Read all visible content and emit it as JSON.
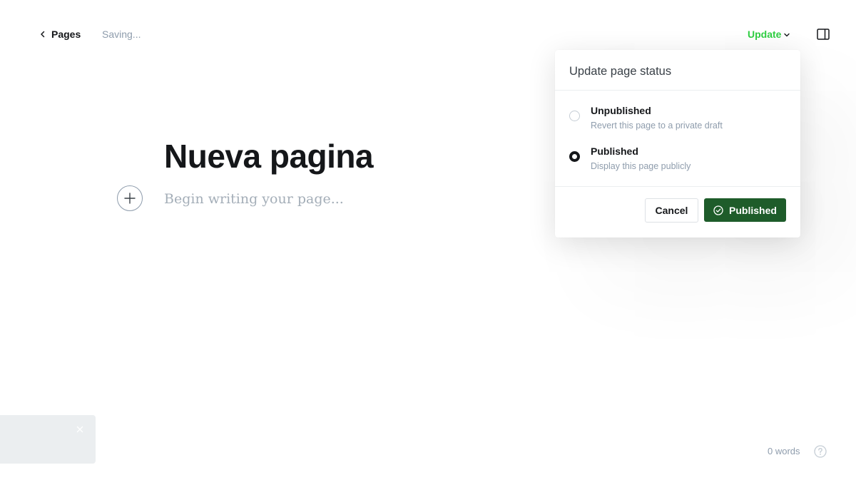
{
  "topbar": {
    "back_label": "Pages",
    "status_text": "Saving...",
    "update_label": "Update"
  },
  "editor": {
    "title": "Nueva pagina",
    "body_placeholder": "Begin writing your page..."
  },
  "popover": {
    "title": "Update page status",
    "options": [
      {
        "label": "Unpublished",
        "description": "Revert this page to a private draft",
        "selected": false
      },
      {
        "label": "Published",
        "description": "Display this page publicly",
        "selected": true
      }
    ],
    "cancel_label": "Cancel",
    "confirm_label": "Published"
  },
  "footer": {
    "word_count": "0 words"
  },
  "colors": {
    "accent_green": "#30cf43",
    "publish_button": "#1e5c2a",
    "text_primary": "#15171a",
    "text_muted": "#8e9cac"
  },
  "icons": {
    "back": "chevron-left-icon",
    "update_dropdown": "chevron-down-icon",
    "sidebar": "sidebar-toggle-icon",
    "add": "plus-icon",
    "publish": "check-circle-icon",
    "toast_close": "close-icon",
    "help": "question-mark-circle-icon"
  }
}
